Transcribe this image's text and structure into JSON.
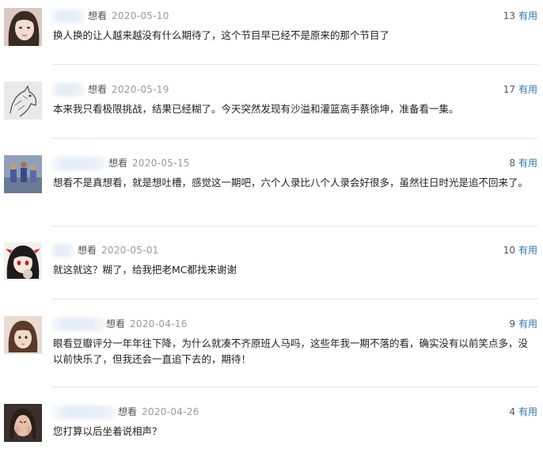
{
  "ui": {
    "accent_color": "#3377aa",
    "divider_color": "#e6e6e6"
  },
  "comments": [
    {
      "avatar": "woman-portrait-avatar",
      "user": "",
      "status": "想看",
      "date": "2020-05-10",
      "votes": "13",
      "useful_label": "有用",
      "text": "换人换的让人越来越没有什么期待了，这个节目早已经不是原来的那个节目了"
    },
    {
      "avatar": "sketch-horse-avatar",
      "user": "",
      "status": "想看",
      "date": "2020-05-19",
      "votes": "17",
      "useful_label": "有用",
      "text": "本来我只看极限挑战，结果已经糊了。今天突然发现有沙溢和灌篮高手蔡徐坤，准备看一集。"
    },
    {
      "avatar": "basketball-players-avatar",
      "user": "",
      "status": "想看",
      "date": "2020-05-15",
      "votes": "8",
      "useful_label": "有用",
      "text": "想看不是真想看，就是想吐槽，感觉这一期吧，六个人录比八个人录会好很多，虽然往日时光是追不回来了。"
    },
    {
      "avatar": "anime-girl-avatar",
      "user": "",
      "status": "想看",
      "date": "2020-05-01",
      "votes": "10",
      "useful_label": "有用",
      "text": "就这就这？糊了，给我把老MC都找来谢谢"
    },
    {
      "avatar": "girl-with-bangs-avatar",
      "user": "",
      "status": "想看",
      "date": "2020-04-16",
      "votes": "9",
      "useful_label": "有用",
      "text": "眼看豆瓣评分一年年往下降，为什么就凑不齐原班人马吗，这些年我一期不落的看，确实没有以前笑点多，没以前快乐了，但我还会一直追下去的，期待！"
    },
    {
      "avatar": "crying-woman-avatar",
      "user": "",
      "status": "想看",
      "date": "2020-04-26",
      "votes": "4",
      "useful_label": "有用",
      "text": "您打算以后坐着说相声？"
    }
  ]
}
